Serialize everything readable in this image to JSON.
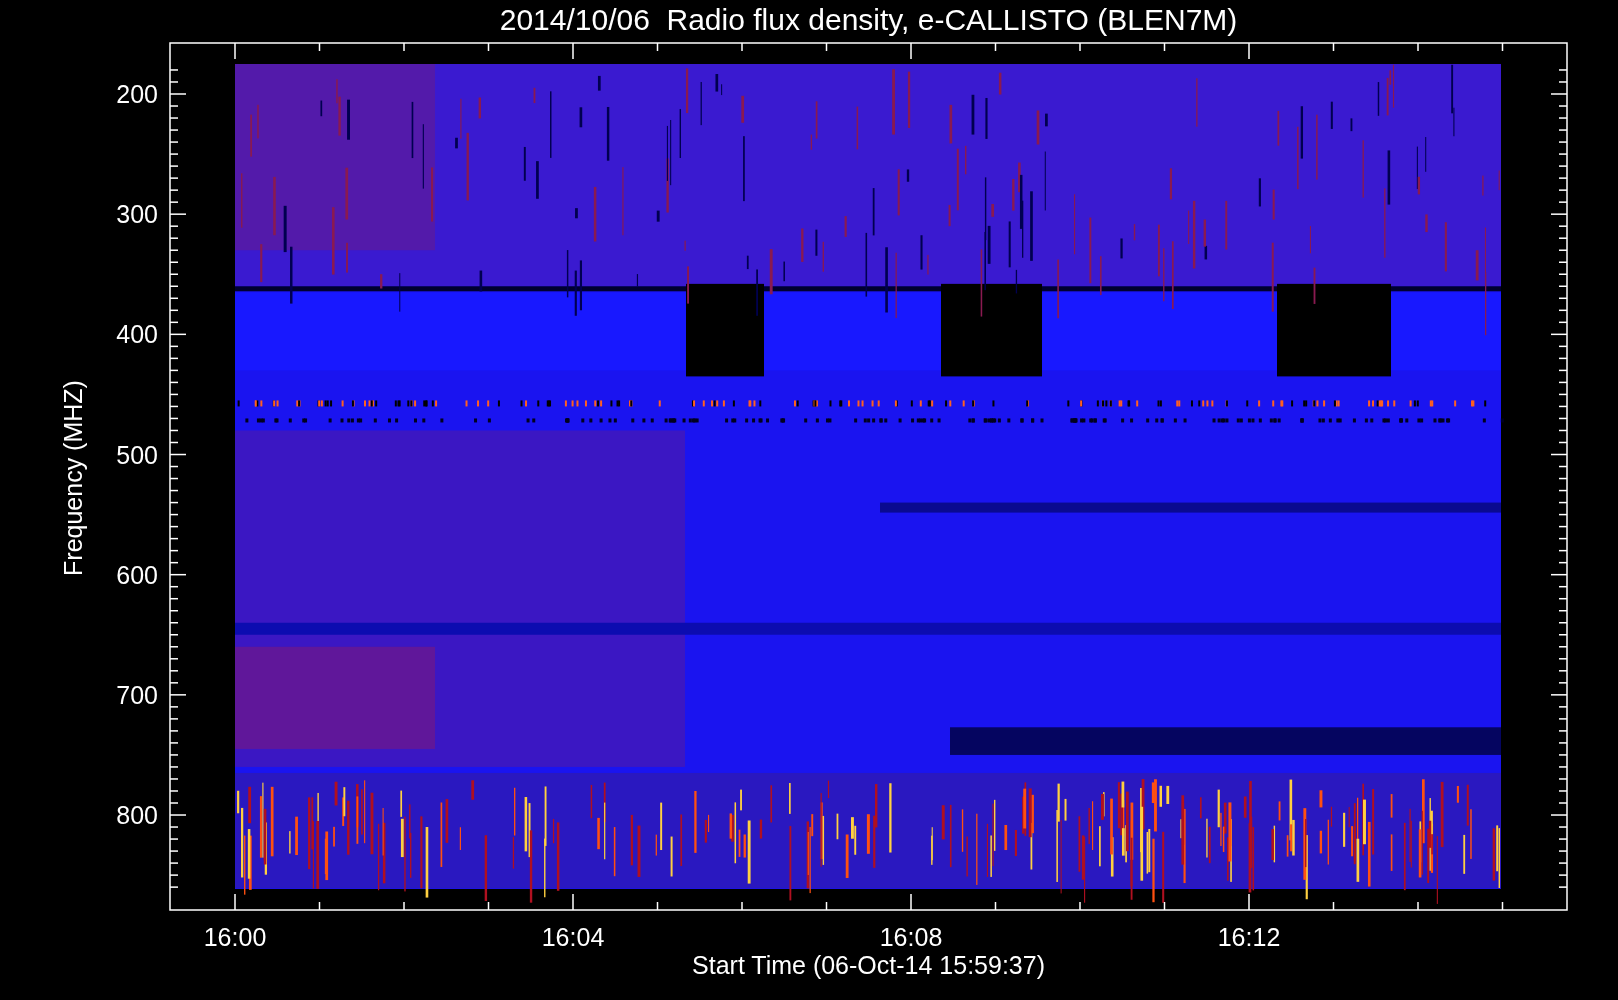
{
  "title": "2014/10/06  Radio flux density, e-CALLISTO (BLEN7M)",
  "y_axis": {
    "label": "Frequency (MHZ)",
    "ticks": [
      "200",
      "300",
      "400",
      "500",
      "600",
      "700",
      "800"
    ]
  },
  "x_axis": {
    "label": "Start Time (06-Oct-14 15:59:37)",
    "ticks": [
      "16:00",
      "16:04",
      "16:08",
      "16:12"
    ]
  }
}
